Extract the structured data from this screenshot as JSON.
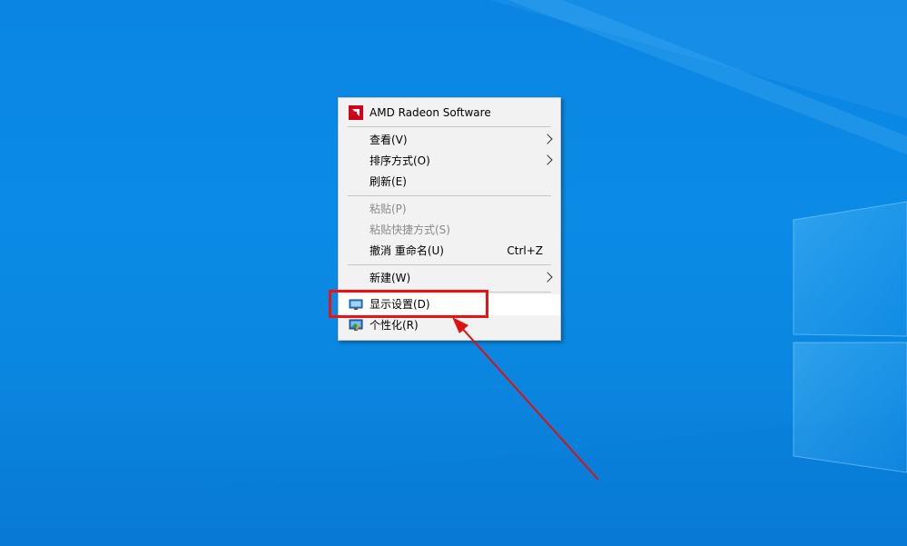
{
  "desktop": {
    "background_color": "#0a86e2"
  },
  "context_menu": {
    "header": {
      "label": "AMD Radeon Software",
      "icon": "amd-radeon-icon"
    },
    "items": [
      {
        "label": "查看(V)",
        "submenu": true
      },
      {
        "label": "排序方式(O)",
        "submenu": true
      },
      {
        "label": "刷新(E)"
      },
      {
        "label": "粘贴(P)",
        "disabled": true
      },
      {
        "label": "粘贴快捷方式(S)",
        "disabled": true
      },
      {
        "label": "撤消 重命名(U)",
        "shortcut": "Ctrl+Z"
      },
      {
        "label": "新建(W)",
        "submenu": true
      },
      {
        "label": "显示设置(D)",
        "icon": "display-settings-icon",
        "highlighted": true
      },
      {
        "label": "个性化(R)",
        "icon": "personalize-icon"
      }
    ]
  },
  "annotation": {
    "box_color": "#ee1111",
    "arrow_color": "#dd1111"
  }
}
